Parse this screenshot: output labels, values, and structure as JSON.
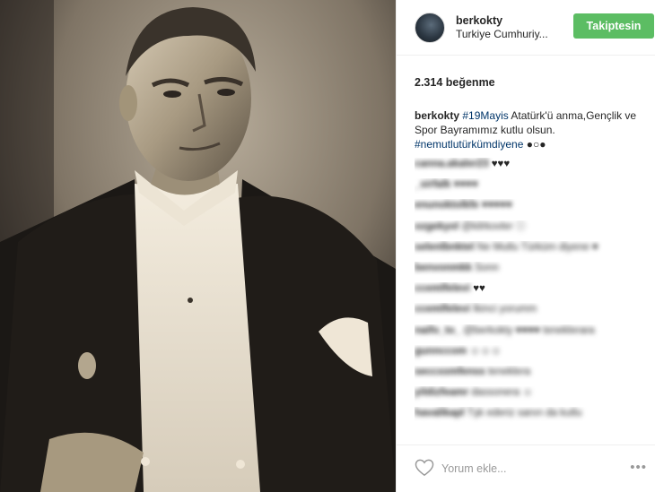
{
  "header": {
    "username": "berkokty",
    "location": "Turkiye Cumhuriy...",
    "follow_label": "Takiptesin"
  },
  "likes": "2.314 beğenme",
  "caption": {
    "username": "berkokty",
    "hashtag1": "#19Mayis",
    "text": " Atatürk'ü anma,Gençlik ve Spor Bayramımız kutlu olsun. ",
    "hashtag2": "#nemutlutürkümdiyene",
    "emoji": "●○●"
  },
  "comments": [
    {
      "user": "canna.akaler23",
      "text": "♥♥♥",
      "blur_text": false
    },
    {
      "user": "_sirfalk",
      "text": "♥♥♥♥",
      "blur_text": true
    },
    {
      "user": "enunoktolkfe",
      "text": "♥♥♥♥♥",
      "blur_text": true
    },
    {
      "user": "ozgekyol",
      "text": "@kilrkovler ⓘ",
      "blur_text": true
    },
    {
      "user": "selenlbnktel",
      "text": "Ne Mutlu Türküm diyene ♥",
      "blur_text": true
    },
    {
      "user": "benvonmkk",
      "text": "Sonn",
      "blur_text": true
    },
    {
      "user": "ccemlfelevi",
      "text": "♥♥",
      "blur_text": false
    },
    {
      "user": "ccemlfelevi",
      "text": "İkinci yorumm",
      "blur_text": true
    },
    {
      "user": "naifo_to_",
      "text": "@berkokty ♥♥♥♥ teneklerara",
      "blur_text": true
    },
    {
      "user": "gunnccom",
      "text": "☺☺☺",
      "blur_text": true
    },
    {
      "user": "seccxxmfenss",
      "text": "teneklera",
      "blur_text": true
    },
    {
      "user": "yildizfeamr",
      "text": "dassonera ☺",
      "blur_text": true
    },
    {
      "user": "havalikapl",
      "text": "Tşk ederiz sanın da kutlu",
      "blur_text": true
    }
  ],
  "footer": {
    "comment_placeholder": "Yorum ekle...",
    "more_label": "•••"
  },
  "icons": {
    "like": "heart-icon",
    "more": "more-options-icon"
  },
  "colors": {
    "follow_button": "#5cbd63",
    "hashtag": "#003569"
  }
}
